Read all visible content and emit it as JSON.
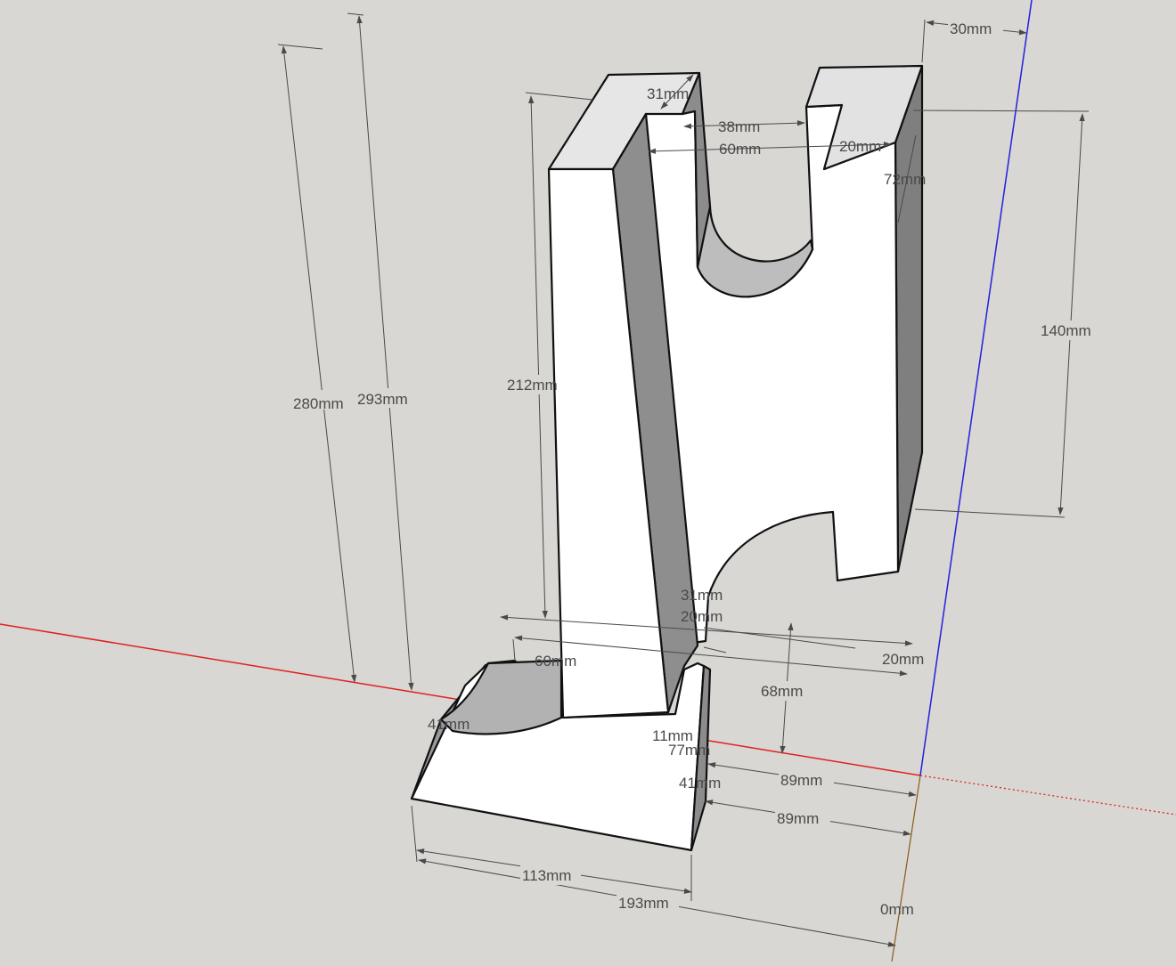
{
  "viewport": {
    "axes": {
      "red": "#e02020",
      "blue": "#2020e0"
    },
    "model": {
      "face_light": "#ffffff",
      "face_mid": "#e4e4e4",
      "face_dark": "#8e8e8e"
    },
    "dimensions": {
      "d30": "30mm",
      "d31_top": "31mm",
      "d38": "38mm",
      "d60_top": "60mm",
      "d20_top": "20mm",
      "d72": "72mm",
      "d140": "140mm",
      "d280": "280mm",
      "d293": "293mm",
      "d212": "212mm",
      "d31_mid": "31mm",
      "d20_mid": "20mm",
      "d20_right": "20mm",
      "d68": "68mm",
      "d60_low": "60mm",
      "d41_left": "41mm",
      "d11": "11mm",
      "d77": "77mm",
      "d41_front": "41mm",
      "d89_a": "89mm",
      "d89_b": "89mm",
      "d113": "113mm",
      "d193": "193mm",
      "d0": "0mm"
    }
  }
}
